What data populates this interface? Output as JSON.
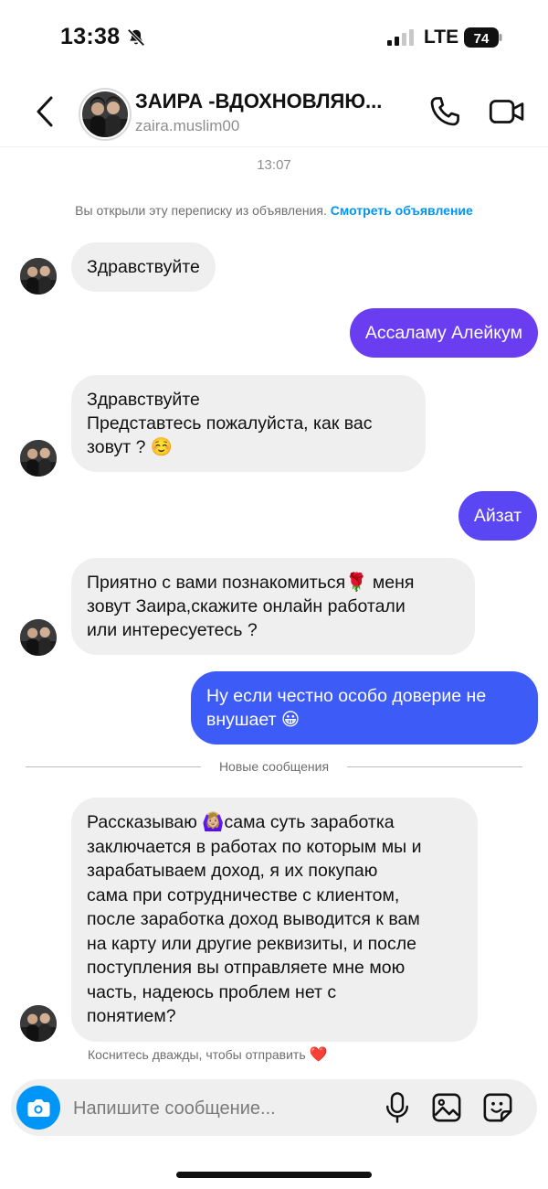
{
  "status_bar": {
    "time": "13:38",
    "network": "LTE",
    "battery": "74"
  },
  "header": {
    "name": "ЗАИРА -ВДОХНОВЛЯЮ...",
    "username": "zaira.muslim00"
  },
  "chat": {
    "time_label": "13:07",
    "ad_note": "Вы открыли эту переписку из объявления.",
    "ad_link": "Смотреть объявление",
    "new_messages_label": "Новые сообщения",
    "messages": [
      {
        "from": "them",
        "lines": [
          "Здравствуйте"
        ]
      },
      {
        "from": "me",
        "lines": [
          "Ассаламу Алейкум"
        ]
      },
      {
        "from": "them",
        "lines": [
          "Здравствуйте",
          "Представтесь пожалуйста, как вас",
          "зовут ? ☺️"
        ]
      },
      {
        "from": "me",
        "lines": [
          "Айзат"
        ]
      },
      {
        "from": "them",
        "lines": [
          "Приятно с вами познакомиться🌹 меня",
          "зовут Заира,скажите онлайн работали",
          "или интересуетесь ?"
        ]
      },
      {
        "from": "me",
        "lines": [
          "Ну если честно особо доверие не",
          "внушает 😀"
        ]
      },
      {
        "from": "them",
        "lines": [
          "Рассказываю 🙆🏼‍♀️сама суть заработка",
          "заключается в работах по которым мы и",
          "зарабатываем доход, я их покупаю",
          "сама при сотрудничестве с клиентом,",
          "после заработка доход выводится к вам",
          "на карту или другие реквизиты, и после",
          "поступления вы отправляете мне мою",
          "часть, надеюсь проблем нет с",
          "понятием?"
        ]
      }
    ],
    "double_tap_hint": "Коснитесь дважды, чтобы отправить",
    "double_tap_emoji": "❤️"
  },
  "composer": {
    "placeholder": "Напишите сообщение..."
  },
  "colors": {
    "accent": "#0095f6",
    "outgoing_purple": "#6a3df0",
    "outgoing_blue": "#3d5cf7",
    "incoming_bg": "#efefef"
  }
}
